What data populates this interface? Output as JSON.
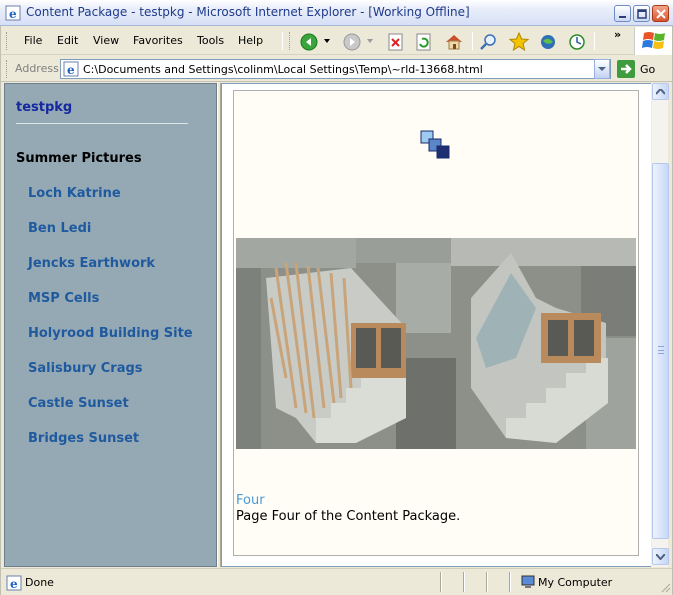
{
  "window": {
    "title": "Content Package - testpkg - Microsoft Internet Explorer - [Working Offline]"
  },
  "menu": {
    "items": [
      "File",
      "Edit",
      "View",
      "Favorites",
      "Tools",
      "Help"
    ]
  },
  "toolbar": {
    "buttons": [
      "back-icon",
      "forward-icon",
      "stop-icon",
      "refresh-icon",
      "home-icon",
      "search-icon",
      "favorites-icon",
      "media-icon",
      "history-icon"
    ],
    "more": "»"
  },
  "address": {
    "label": "Address",
    "value": "C:\\Documents and Settings\\colinm\\Local Settings\\Temp\\~rld-13668.html",
    "go_label": "Go"
  },
  "nav": {
    "package_title": "testpkg",
    "section_title": "Summer Pictures",
    "links": [
      "Loch Katrine",
      "Ben Ledi",
      "Jencks Earthwork",
      "MSP Cells",
      "Holyrood Building Site",
      "Salisbury Crags",
      "Castle Sunset",
      "Bridges Sunset"
    ]
  },
  "content": {
    "heading": "Four",
    "description": "Page Four of the Content Package."
  },
  "status": {
    "text": "Done",
    "zone": "My Computer"
  },
  "colors": {
    "nav_background": "#95a9b5",
    "nav_link": "#1f5a9e",
    "package_title": "#1428a0",
    "heading": "#4b9ad6"
  }
}
